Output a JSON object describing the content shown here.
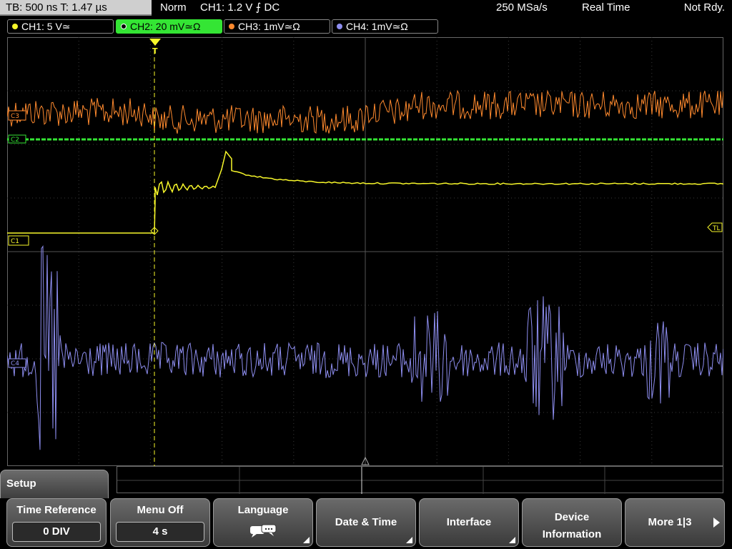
{
  "status": {
    "timebase": "TB: 500 ns   T: 1.47 µs",
    "mode": "Norm",
    "trigger": "CH1: 1.2 V ⨍ DC",
    "sample_rate": "250 MSa/s",
    "acquisition": "Real Time",
    "state": "Not Rdy."
  },
  "channels": [
    {
      "label": "CH1: 5 V≃",
      "color": "#f7f72a",
      "active": false
    },
    {
      "label": "CH2: 20 mV≃Ω",
      "color": "#34e534",
      "active": true
    },
    {
      "label": "CH3: 1mV≃Ω",
      "color": "#ff8a2e",
      "active": false
    },
    {
      "label": "CH4: 1mV≃Ω",
      "color": "#8e8ef0",
      "active": false
    }
  ],
  "markers": {
    "trigger_level": "TL",
    "ch1_ground": "C1",
    "ch2_ground": "C2",
    "ch3_ground": "C3",
    "ch4_ground": "C4",
    "trigger_time": "T"
  },
  "menu": {
    "title": "Setup",
    "softkeys": [
      {
        "label": "Time Reference",
        "value": "0 DIV"
      },
      {
        "label": "Menu Off",
        "value": "4 s"
      },
      {
        "label": "Language",
        "icon": "speech-bubbles-icon"
      },
      {
        "label": "Date & Time"
      },
      {
        "label": "Interface"
      },
      {
        "label": "Device",
        "label2": "Information"
      },
      {
        "label": "More 1|3"
      }
    ]
  },
  "colors": {
    "grid": "#3a3a3a",
    "ch1": "#f7f72a",
    "ch2": "#34e534",
    "ch3": "#ff8a2e",
    "ch4": "#8e8ef0"
  }
}
